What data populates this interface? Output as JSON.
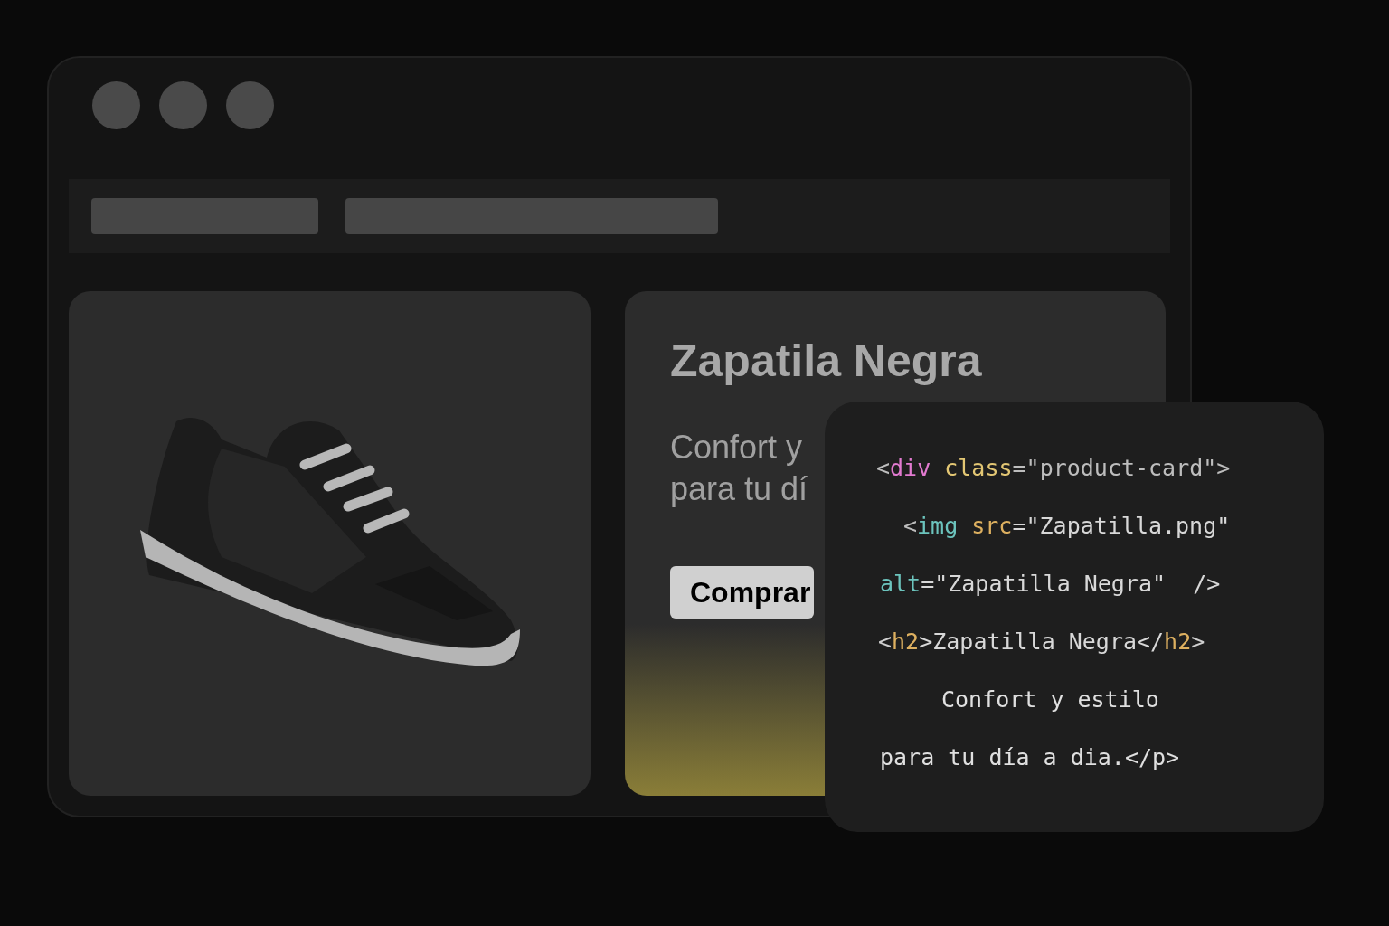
{
  "product_card": {
    "title": "Zapatila Negra",
    "description_lines": [
      "Confort y",
      "para tu dí"
    ],
    "button": "Comprar"
  },
  "code_panel": {
    "lines": [
      {
        "tokens": [
          {
            "text": "<",
            "color": "#bdbdbd"
          },
          {
            "text": "div",
            "color": "#e27ad0"
          },
          {
            "text": " class",
            "color": "#e3c774"
          },
          {
            "text": "=\"product-card\">",
            "color": "#bdbdbd"
          }
        ]
      },
      {
        "tokens": [
          {
            "text": "<",
            "color": "#bdbdbd"
          },
          {
            "text": "img",
            "color": "#6cc4bd"
          },
          {
            "text": " src",
            "color": "#ddb060"
          },
          {
            "text": "=\"Zapatilla.png\"",
            "color": "#d8d8d8"
          }
        ]
      },
      {
        "tokens": [
          {
            "text": "alt",
            "color": "#6cc4bd"
          },
          {
            "text": "=\"Zapatilla Negra\"  />",
            "color": "#d8d8d8"
          }
        ]
      },
      {
        "tokens": [
          {
            "text": "<",
            "color": "#cfcfcf"
          },
          {
            "text": "h2",
            "color": "#ddb060"
          },
          {
            "text": ">Zapatilla Negra</",
            "color": "#d8d8d8"
          },
          {
            "text": "h2",
            "color": "#ddb060"
          },
          {
            "text": ">",
            "color": "#cfcfcf"
          }
        ]
      },
      {
        "tokens": [
          {
            "text": "Confort y estilo",
            "color": "#e0e0e0"
          }
        ]
      },
      {
        "tokens": [
          {
            "text": "para tu día a dia.</p>",
            "color": "#e0e0e0"
          }
        ]
      }
    ]
  }
}
